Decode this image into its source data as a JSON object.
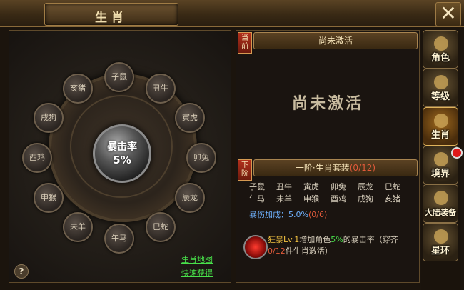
{
  "window": {
    "title": "生肖",
    "close_label": "✕"
  },
  "wheel": {
    "nodes": [
      "子鼠",
      "丑牛",
      "寅虎",
      "卯兔",
      "辰龙",
      "巳蛇",
      "午马",
      "未羊",
      "申猴",
      "酉鸡",
      "戌狗",
      "亥猪"
    ],
    "center_label": "暴击率",
    "center_value": "5%"
  },
  "help_label": "?",
  "links": {
    "map": "生肖地图",
    "quick": "快速获得"
  },
  "current": {
    "tag": "当前",
    "header": "尚未激活",
    "status": "尚未激活"
  },
  "next": {
    "tag": "下阶",
    "header_prefix": "一阶·生肖套装",
    "header_count": "(0/12)",
    "zodiac_rows": [
      [
        "子鼠",
        "丑牛",
        "寅虎",
        "卯兔",
        "辰龙",
        "巳蛇"
      ],
      [
        "午马",
        "未羊",
        "申猴",
        "酉鸡",
        "戌狗",
        "亥猪"
      ]
    ],
    "bonus_label": "暴伤加成：5.0%",
    "bonus_count": "(0/6)",
    "skill_name": "狂暴Lv.1",
    "skill_text_a": "增加角色",
    "skill_pct": "5%",
    "skill_text_b": "的暴击率（穿齐",
    "skill_count": "0/12",
    "skill_text_c": "件生肖激活）"
  },
  "sidenav": [
    {
      "label": "角色"
    },
    {
      "label": "等级"
    },
    {
      "label": "生肖",
      "active": true
    },
    {
      "label": "境界"
    },
    {
      "label": "大陆装备"
    },
    {
      "label": "星环"
    }
  ],
  "colors": {
    "gold": "#f2dfb0",
    "link_green": "#48e04a",
    "bonus_blue": "#6fb2ff",
    "count_red": "#e05a3a",
    "active_orange": "#a06a1e"
  }
}
